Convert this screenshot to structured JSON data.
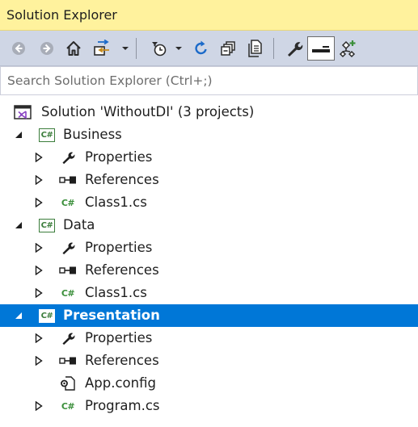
{
  "window": {
    "title": "Solution Explorer"
  },
  "toolbar": {
    "buttons": [
      {
        "name": "back-icon"
      },
      {
        "name": "forward-icon"
      },
      {
        "name": "home-icon"
      },
      {
        "name": "sync-with-active-document-icon"
      },
      {
        "name": "pending-changes-filter-icon"
      },
      {
        "name": "refresh-icon"
      },
      {
        "name": "collapse-all-icon"
      },
      {
        "name": "show-all-files-icon"
      },
      {
        "name": "properties-icon"
      },
      {
        "name": "preview-selected-items-icon"
      },
      {
        "name": "class-view-icon"
      }
    ]
  },
  "search": {
    "placeholder": "Search Solution Explorer (Ctrl+;)",
    "value": ""
  },
  "tree": {
    "solution": {
      "label": "Solution 'WithoutDI' (3 projects)"
    },
    "projects": [
      {
        "label": "Business",
        "expanded": true,
        "selected": false,
        "children": [
          {
            "label": "Properties",
            "icon": "wrench-icon",
            "expandable": true
          },
          {
            "label": "References",
            "icon": "references-icon",
            "expandable": true
          },
          {
            "label": "Class1.cs",
            "icon": "csharp-file-icon",
            "expandable": true
          }
        ]
      },
      {
        "label": "Data",
        "expanded": true,
        "selected": false,
        "children": [
          {
            "label": "Properties",
            "icon": "wrench-icon",
            "expandable": true
          },
          {
            "label": "References",
            "icon": "references-icon",
            "expandable": true
          },
          {
            "label": "Class1.cs",
            "icon": "csharp-file-icon",
            "expandable": true
          }
        ]
      },
      {
        "label": "Presentation",
        "expanded": true,
        "selected": true,
        "children": [
          {
            "label": "Properties",
            "icon": "wrench-icon",
            "expandable": true
          },
          {
            "label": "References",
            "icon": "references-icon",
            "expandable": true
          },
          {
            "label": "App.config",
            "icon": "config-file-icon",
            "expandable": false
          },
          {
            "label": "Program.cs",
            "icon": "csharp-file-icon",
            "expandable": true
          }
        ]
      }
    ]
  },
  "colors": {
    "title_bg": "#fff29d",
    "toolbar_bg": "#cfd6e5",
    "selection": "#0077d7",
    "csharp_green": "#3b7d3b"
  }
}
